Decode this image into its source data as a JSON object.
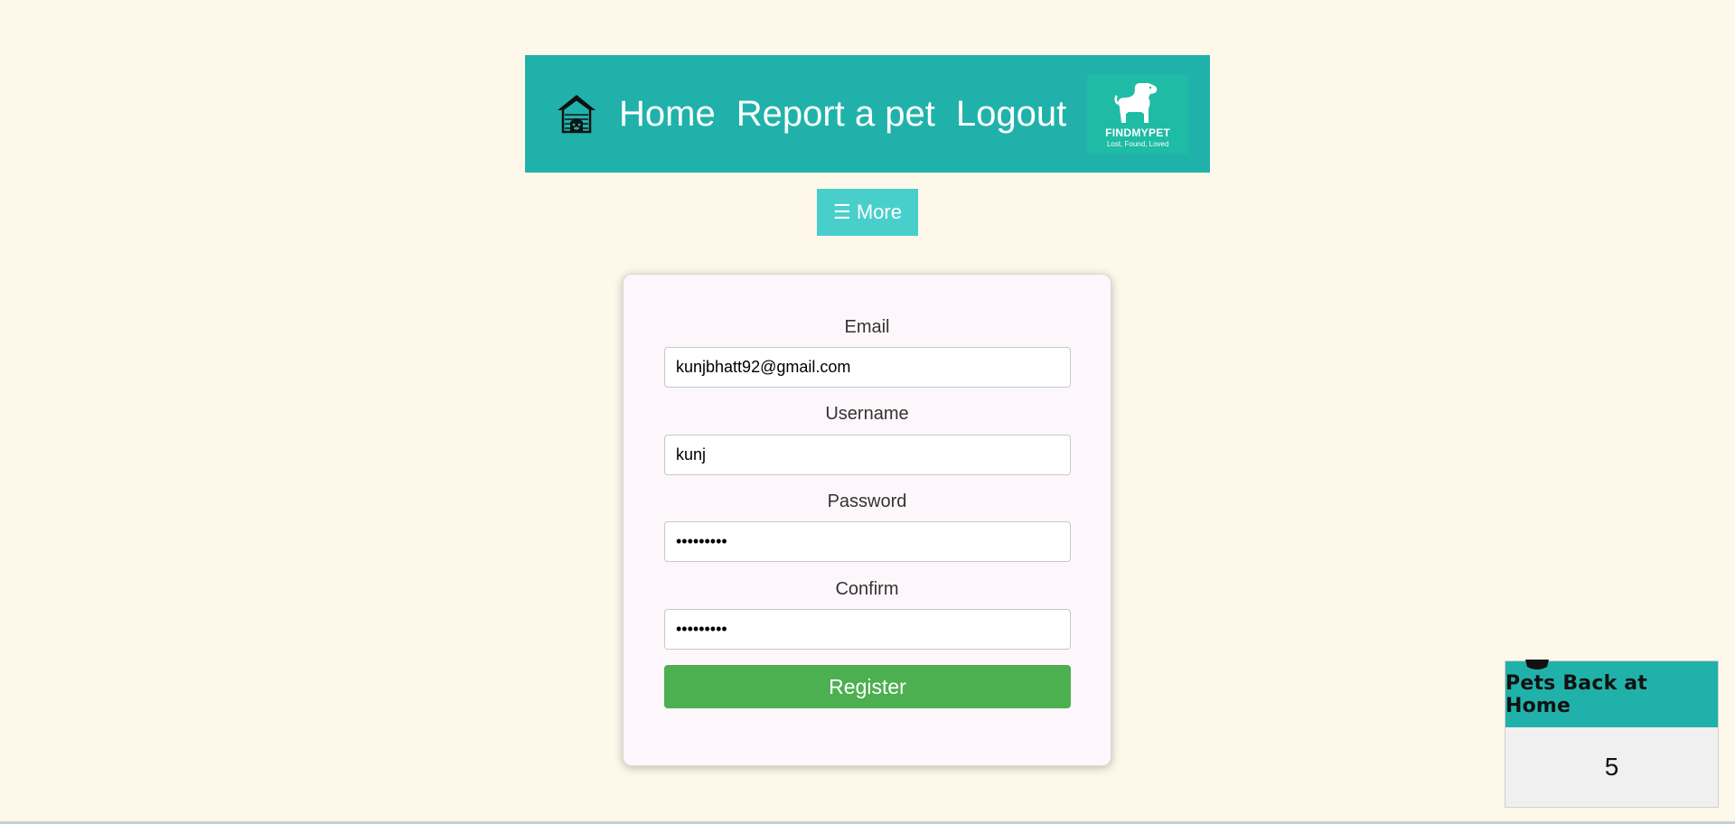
{
  "nav": {
    "home_label": "Home",
    "report_label": "Report a pet",
    "logout_label": "Logout",
    "logo": {
      "title": "FINDMYPET",
      "tagline": "Lost, Found, Loved"
    }
  },
  "more_button": {
    "label": "☰ More"
  },
  "form": {
    "email": {
      "label": "Email",
      "value": "kunjbhatt92@gmail.com"
    },
    "username": {
      "label": "Username",
      "value": "kunj"
    },
    "password": {
      "label": "Password",
      "value": "•••••••••"
    },
    "confirm": {
      "label": "Confirm",
      "value": "•••••••••"
    },
    "submit_label": "Register"
  },
  "stats": {
    "title": "Pets Back at Home",
    "value": "5"
  },
  "colors": {
    "page_bg": "#fef8ea",
    "nav_bg": "#20b2aa",
    "more_bg": "#48cfcb",
    "register_bg": "#4caf50"
  }
}
